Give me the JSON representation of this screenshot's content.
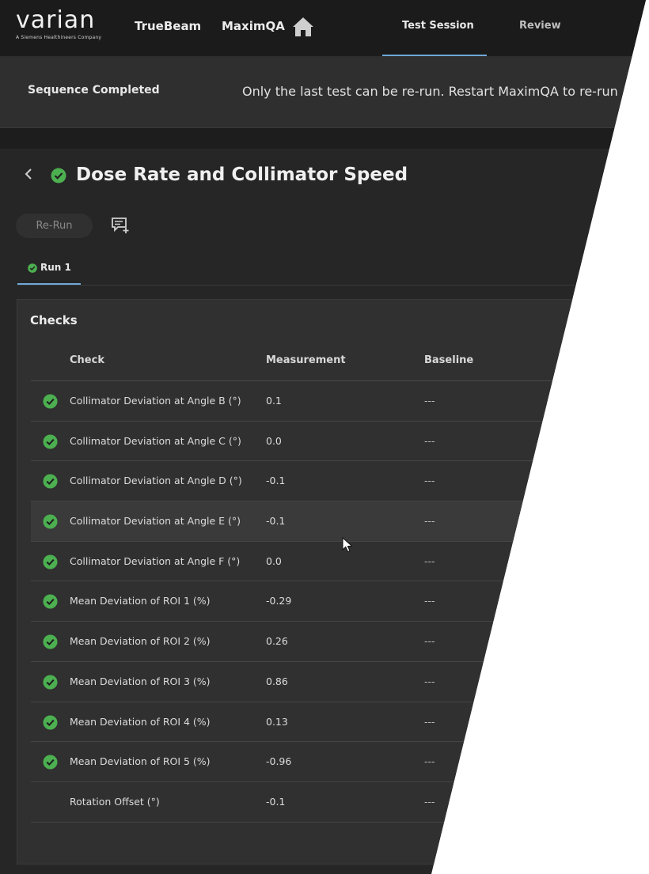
{
  "brand": {
    "name": "varian",
    "tagline": "A Siemens Healthineers Company"
  },
  "nav": {
    "items": [
      "TrueBeam",
      "MaximQA"
    ],
    "tabs": [
      {
        "label": "Test Session",
        "active": true
      },
      {
        "label": "Review",
        "active": false
      }
    ]
  },
  "banner": {
    "title": "Sequence Completed",
    "message": "Only the last test can be re-run. Restart MaximQA to re-run"
  },
  "test": {
    "title": "Dose Rate and Collimator Speed",
    "status": "pass",
    "rerun_label": "Re-Run",
    "run_tab": "Run 1"
  },
  "checks": {
    "title": "Checks",
    "columns": [
      "Check",
      "Measurement",
      "Baseline"
    ],
    "rows": [
      {
        "check": "Collimator Deviation at Angle B (°)",
        "measurement": "0.1",
        "baseline": "---",
        "pass": true
      },
      {
        "check": "Collimator Deviation at Angle C (°)",
        "measurement": "0.0",
        "baseline": "---",
        "pass": true
      },
      {
        "check": "Collimator Deviation at Angle D (°)",
        "measurement": "-0.1",
        "baseline": "---",
        "pass": true
      },
      {
        "check": "Collimator Deviation at Angle E (°)",
        "measurement": "-0.1",
        "baseline": "---",
        "pass": true
      },
      {
        "check": "Collimator Deviation at Angle F (°)",
        "measurement": "0.0",
        "baseline": "---",
        "pass": true
      },
      {
        "check": "Mean Deviation of ROI 1 (%)",
        "measurement": "-0.29",
        "baseline": "---",
        "pass": true
      },
      {
        "check": "Mean Deviation of ROI 2 (%)",
        "measurement": "0.26",
        "baseline": "---",
        "pass": true
      },
      {
        "check": "Mean Deviation of ROI 3 (%)",
        "measurement": "0.86",
        "baseline": "---",
        "pass": true
      },
      {
        "check": "Mean Deviation of ROI 4 (%)",
        "measurement": "0.13",
        "baseline": "---",
        "pass": true
      },
      {
        "check": "Mean Deviation of ROI 5 (%)",
        "measurement": "-0.96",
        "baseline": "---",
        "pass": true
      },
      {
        "check": "Rotation Offset (°)",
        "measurement": "-0.1",
        "baseline": "---",
        "pass": false
      }
    ]
  },
  "colors": {
    "background": "#262626",
    "nav_background": "#1b1b1b",
    "panel_background": "#303030",
    "accent": "#6fa8d8",
    "pass_green": "#4caf50"
  },
  "icons": [
    "home-icon",
    "back-chevron-icon",
    "check-circle-icon",
    "comment-add-icon",
    "mouse-cursor-icon"
  ]
}
